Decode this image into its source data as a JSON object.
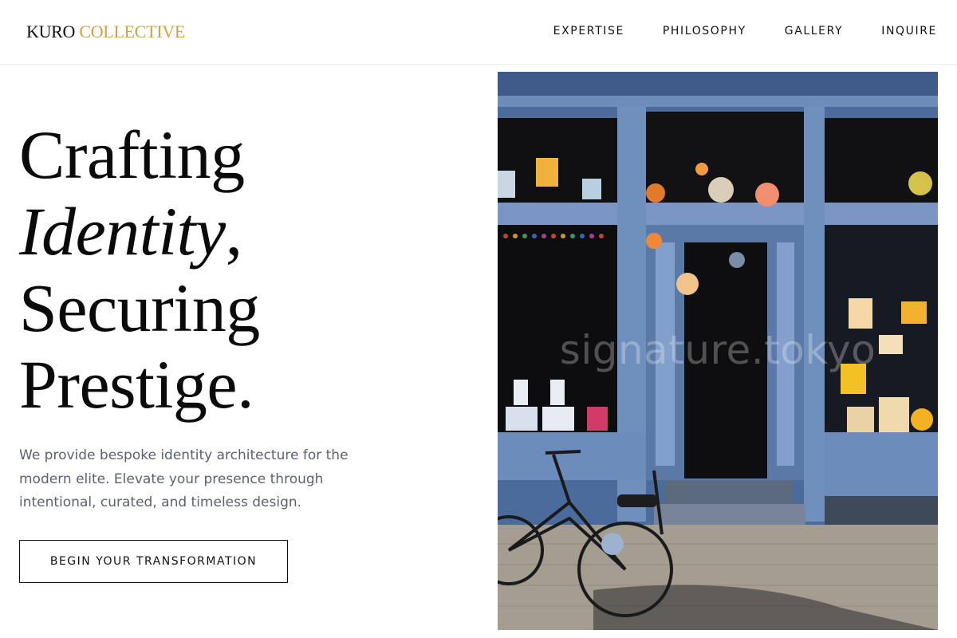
{
  "header": {
    "logo_primary": "KURO",
    "logo_accent": "COLLECTIVE",
    "nav": [
      "EXPERTISE",
      "PHILOSOPHY",
      "GALLERY",
      "INQUIRE"
    ]
  },
  "hero": {
    "title_line1": "Crafting",
    "title_line2_italic": "Identity",
    "title_line2_punct": ",",
    "title_line3": "Securing",
    "title_line4": "Prestige.",
    "description": "We provide bespoke identity architecture for the modern elite. Elevate your presence through intentional, curated, and timeless design.",
    "cta_label": "BEGIN YOUR TRANSFORMATION"
  },
  "image": {
    "watermark": "signature.tokyo",
    "alt": "storefront-photo"
  },
  "colors": {
    "accent": "#c9a448",
    "text": "#111111",
    "muted": "#5b6270",
    "storefront_blue": "#5f7fae"
  }
}
